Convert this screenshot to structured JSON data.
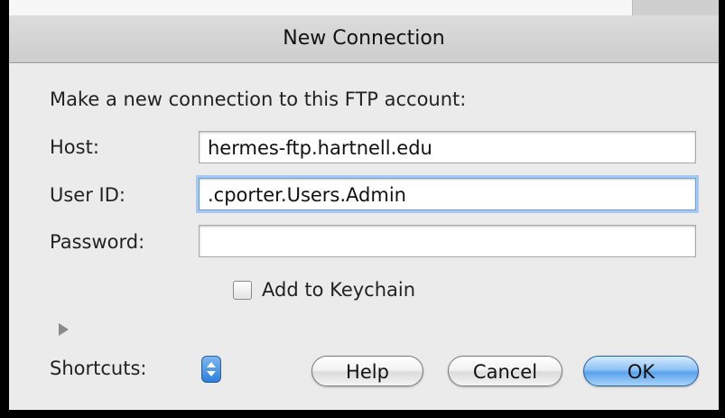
{
  "dialog": {
    "title": "New Connection",
    "prompt": "Make a new connection to this FTP account:"
  },
  "form": {
    "host_label": "Host:",
    "host_value": "hermes-ftp.hartnell.edu",
    "user_label": "User ID:",
    "user_value": ".cporter.Users.Admin",
    "password_label": "Password:",
    "password_value": "",
    "keychain_label": "Add to Keychain",
    "keychain_checked": false
  },
  "footer": {
    "shortcuts_label": "Shortcuts:",
    "help_label": "Help",
    "cancel_label": "Cancel",
    "ok_label": "OK"
  },
  "icons": {
    "disclosure": "disclosure-triangle-icon",
    "stepper": "up-down-stepper-icon"
  },
  "colors": {
    "default_button": "#5aa2ec",
    "focus_ring": "#a9c8ee"
  }
}
